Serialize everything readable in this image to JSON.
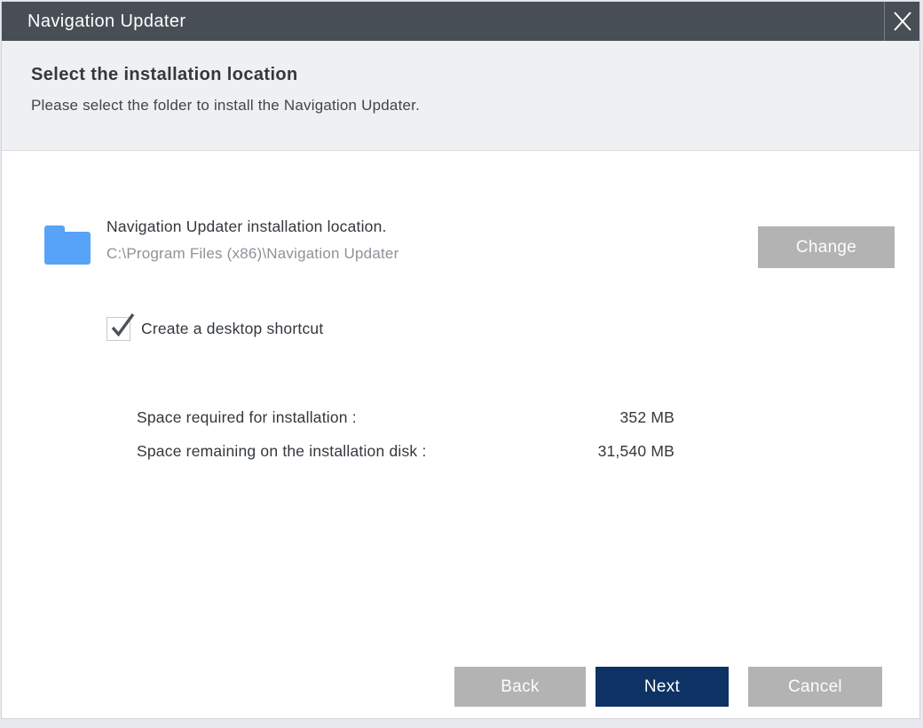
{
  "window": {
    "title": "Navigation Updater"
  },
  "header": {
    "title": "Select the installation location",
    "subtitle": "Please select the folder to install the Navigation Updater."
  },
  "install_location": {
    "label": "Navigation Updater installation location.",
    "path": "C:\\Program Files (x86)\\Navigation Updater",
    "change_button": "Change"
  },
  "options": {
    "desktop_shortcut": {
      "label": "Create a desktop shortcut",
      "checked": true
    }
  },
  "space_info": {
    "rows": [
      {
        "label": "Space required for installation :",
        "value": "352 MB"
      },
      {
        "label": "Space remaining on the installation disk :",
        "value": "31,540 MB"
      }
    ]
  },
  "footer": {
    "back": "Back",
    "next": "Next",
    "cancel": "Cancel"
  },
  "colors": {
    "titlebar": "#474E55",
    "header_bg": "#EFF0F2",
    "accent_navy": "#0E3264",
    "button_gray": "#B3B3B3",
    "folder_blue": "#57A3F7"
  }
}
